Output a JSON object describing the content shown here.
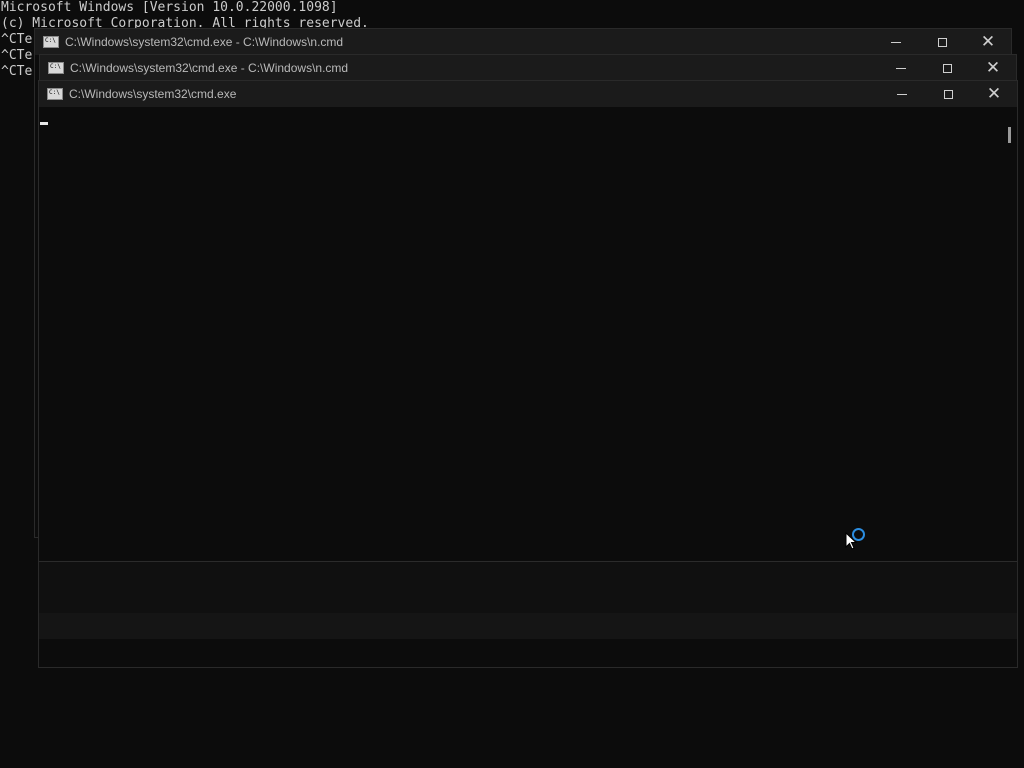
{
  "background_console": {
    "lines": [
      "Microsoft Windows [Version 10.0.22000.1098]",
      "(c) Microsoft Corporation. All rights reserved.",
      "^CTe",
      "^CTe",
      "^CTe"
    ]
  },
  "windows": [
    {
      "title": "C:\\Windows\\system32\\cmd.exe - C:\\Windows\\n.cmd"
    },
    {
      "title": "C:\\Windows\\system32\\cmd.exe - C:\\Windows\\n.cmd"
    },
    {
      "title": "C:\\Windows\\system32\\cmd.exe"
    }
  ],
  "colors": {
    "console_bg": "#0c0c0c",
    "titlebar_bg": "#1b1b1b",
    "spinner_accent": "#2b8de0"
  },
  "icons": [
    "cmd-icon",
    "minimize-icon",
    "maximize-icon",
    "close-icon",
    "mouse-cursor-icon",
    "busy-spinner-icon"
  ]
}
